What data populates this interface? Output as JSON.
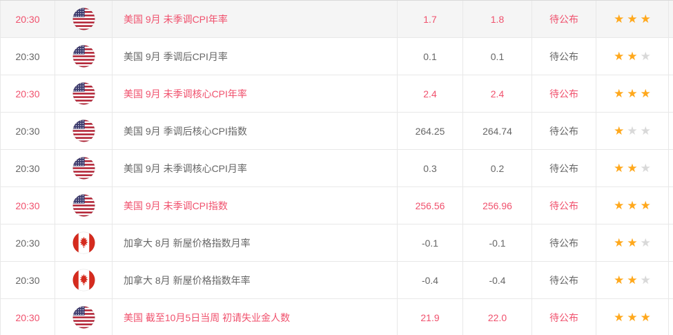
{
  "colors": {
    "accent_pink": "#f0516d",
    "star_gold": "#ffa81c",
    "star_inactive": "#d9d9d9",
    "us_flag_blue": "#3c3b6e",
    "us_flag_red": "#b22234",
    "canada_flag_red": "#d52b1e"
  },
  "table": {
    "max_stars": 3,
    "rows": [
      {
        "time": "20:30",
        "country": "us",
        "event": "美国 9月 未季调CPI年率",
        "previous": "1.7",
        "forecast": "1.8",
        "status": "待公布",
        "stars": 3,
        "highlighted": true,
        "hovered": true
      },
      {
        "time": "20:30",
        "country": "us",
        "event": "美国 9月 季调后CPI月率",
        "previous": "0.1",
        "forecast": "0.1",
        "status": "待公布",
        "stars": 2,
        "highlighted": false,
        "hovered": false
      },
      {
        "time": "20:30",
        "country": "us",
        "event": "美国 9月 未季调核心CPI年率",
        "previous": "2.4",
        "forecast": "2.4",
        "status": "待公布",
        "stars": 3,
        "highlighted": true,
        "hovered": false
      },
      {
        "time": "20:30",
        "country": "us",
        "event": "美国 9月 季调后核心CPI指数",
        "previous": "264.25",
        "forecast": "264.74",
        "status": "待公布",
        "stars": 1,
        "highlighted": false,
        "hovered": false
      },
      {
        "time": "20:30",
        "country": "us",
        "event": "美国 9月 未季调核心CPI月率",
        "previous": "0.3",
        "forecast": "0.2",
        "status": "待公布",
        "stars": 2,
        "highlighted": false,
        "hovered": false
      },
      {
        "time": "20:30",
        "country": "us",
        "event": "美国 9月 未季调CPI指数",
        "previous": "256.56",
        "forecast": "256.96",
        "status": "待公布",
        "stars": 3,
        "highlighted": true,
        "hovered": false
      },
      {
        "time": "20:30",
        "country": "ca",
        "event": "加拿大 8月 新屋价格指数月率",
        "previous": "-0.1",
        "forecast": "-0.1",
        "status": "待公布",
        "stars": 2,
        "highlighted": false,
        "hovered": false
      },
      {
        "time": "20:30",
        "country": "ca",
        "event": "加拿大 8月 新屋价格指数年率",
        "previous": "-0.4",
        "forecast": "-0.4",
        "status": "待公布",
        "stars": 2,
        "highlighted": false,
        "hovered": false
      },
      {
        "time": "20:30",
        "country": "us",
        "event": "美国 截至10月5日当周 初请失业金人数",
        "previous": "21.9",
        "forecast": "22.0",
        "status": "待公布",
        "stars": 3,
        "highlighted": true,
        "hovered": false
      }
    ]
  }
}
